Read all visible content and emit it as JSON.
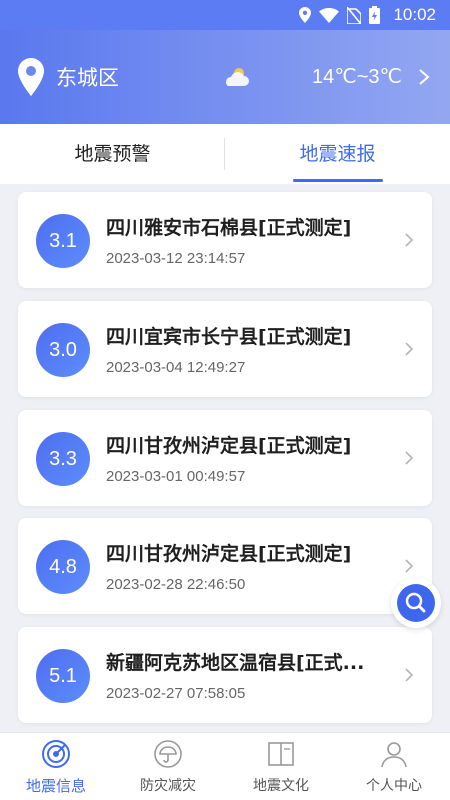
{
  "status_bar": {
    "time": "10:02"
  },
  "header": {
    "location": "东城区",
    "temperature": "14℃~3℃",
    "weather_icon": "cloudy-sun-icon"
  },
  "tabs": [
    {
      "label": "地震预警",
      "active": false
    },
    {
      "label": "地震速报",
      "active": true
    }
  ],
  "quakes": [
    {
      "magnitude": "3.1",
      "title": "四川雅安市石棉县[正式测定]",
      "time": "2023-03-12 23:14:57"
    },
    {
      "magnitude": "3.0",
      "title": "四川宜宾市长宁县[正式测定]",
      "time": "2023-03-04 12:49:27"
    },
    {
      "magnitude": "3.3",
      "title": "四川甘孜州泸定县[正式测定]",
      "time": "2023-03-01 00:49:57"
    },
    {
      "magnitude": "4.8",
      "title": "四川甘孜州泸定县[正式测定]",
      "time": "2023-02-28 22:46:50"
    },
    {
      "magnitude": "5.1",
      "title": "新疆阿克苏地区温宿县[正式...",
      "time": "2023-02-27 07:58:05"
    }
  ],
  "bottom_nav": [
    {
      "label": "地震信息",
      "icon": "radar-icon",
      "active": true
    },
    {
      "label": "防灾减灾",
      "icon": "umbrella-icon",
      "active": false
    },
    {
      "label": "地震文化",
      "icon": "book-icon",
      "active": false
    },
    {
      "label": "个人中心",
      "icon": "person-icon",
      "active": false
    }
  ],
  "colors": {
    "accent": "#3d6cf0",
    "header_start": "#5a78ef",
    "header_end": "#93a7f1"
  }
}
